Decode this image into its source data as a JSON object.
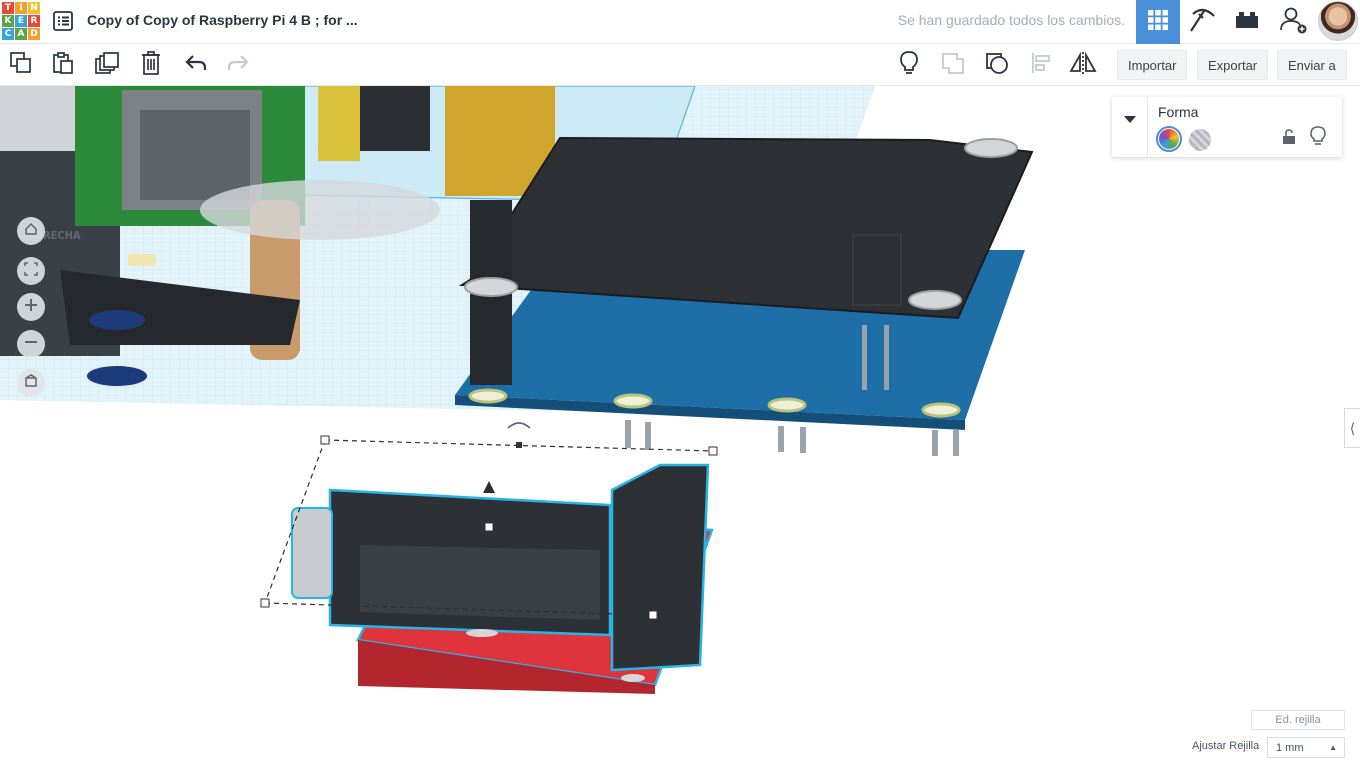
{
  "app": {
    "logo_letters": [
      "T",
      "I",
      "N",
      "K",
      "E",
      "R",
      "C",
      "A",
      "D"
    ],
    "logo_colors": [
      "#e84a3d",
      "#f2a22c",
      "#f2c12e",
      "#5aa447",
      "#38a3d8",
      "#e84a3d",
      "#38a3d8",
      "#5aa447",
      "#f2a22c"
    ]
  },
  "header": {
    "title": "Copy of Copy of Raspberry Pi 4 B ; for ...",
    "save_status": "Se han guardado todos los cambios."
  },
  "toolbar": {
    "import_label": "Importar",
    "export_label": "Exportar",
    "send_label": "Enviar a"
  },
  "viewcube": {
    "label": "DERECHA"
  },
  "inspector": {
    "title": "Forma"
  },
  "grid": {
    "edit_label": "Ed. rejilla",
    "snap_label": "Ajustar Rejilla",
    "snap_value": "1 mm"
  },
  "colors": {
    "accent": "#4a90d9",
    "pcb_blue": "#1e6fa8",
    "adapter_red": "#e0343d",
    "component_dark": "#2d3136",
    "selection_outline": "#28b4e6"
  }
}
